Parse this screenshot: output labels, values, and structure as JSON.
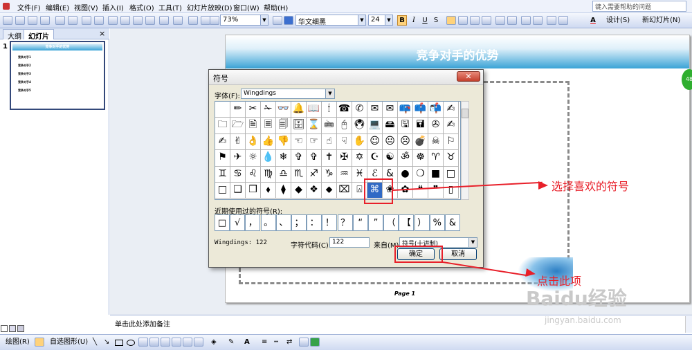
{
  "menu": {
    "items": [
      "文件(F)",
      "编辑(E)",
      "视图(V)",
      "插入(I)",
      "格式(O)",
      "工具(T)",
      "幻灯片放映(D)",
      "窗口(W)",
      "帮助(H)"
    ],
    "help_placeholder": "键入需要帮助的问题"
  },
  "toolbar": {
    "zoom": "73%",
    "font_name": "华文细黑",
    "font_size": "24",
    "bold": "B",
    "italic": "I",
    "underline": "U",
    "shadow": "S",
    "design_label": "设计(S)",
    "new_slide_label": "新幻灯片(N)"
  },
  "left_pane": {
    "tabs": [
      "大纲",
      "幻灯片"
    ],
    "slide_number": "1",
    "thumb_title": "竞争对手的优势",
    "thumb_lines": [
      "竞争对手1",
      "竞争对手2",
      "竞争对手3",
      "竞争对手4",
      "竞争对手5"
    ]
  },
  "slide": {
    "title": "竞争对手的优势",
    "page_label": "Page 1"
  },
  "notes": {
    "placeholder": "单击此处添加备注"
  },
  "drawing_toolbar": {
    "draw_label": "绘图(R)",
    "autoshapes_label": "自选图形(U)"
  },
  "dialog": {
    "title": "符号",
    "font_label": "字体(F):",
    "font_value": "Wingdings",
    "symbols": [
      "",
      "✏",
      "✂",
      "✁",
      "👓",
      "🔔",
      "📖",
      "🕯",
      "☎",
      "✆",
      "✉",
      "✉",
      "📪",
      "📫",
      "📬",
      "✍",
      "🗀",
      "🗁",
      "🗎",
      "🗏",
      "🗐",
      "🗄",
      "⌛",
      "🖮",
      "🖰",
      "🖲",
      "💻",
      "🖴",
      "🖫",
      "🖬",
      "✇",
      "✍",
      "✍",
      "✌",
      "👌",
      "👍",
      "👎",
      "☜",
      "☞",
      "☝",
      "☟",
      "✋",
      "☺",
      "😐",
      "☹",
      "💣",
      "☠",
      "⚐",
      "⚑",
      "✈",
      "☼",
      "💧",
      "❄",
      "✞",
      "✞",
      "✝",
      "✠",
      "✡",
      "☪",
      "☯",
      "ॐ",
      "☸",
      "♈",
      "♉",
      "♊",
      "♋",
      "♌",
      "♍",
      "♎",
      "♏",
      "♐",
      "♑",
      "♒",
      "♓",
      "ℰ",
      "&",
      "●",
      "❍",
      "■",
      "□",
      "□",
      "❑",
      "❒",
      "⬧",
      "⧫",
      "◆",
      "❖",
      "⬥",
      "⌧",
      "⍓",
      "⌘",
      "❀",
      "✿",
      "❝",
      "❞",
      "▯"
    ],
    "selected_symbol": "⌘",
    "recent_label": "近期使用过的符号(R):",
    "recent": [
      "□",
      "√",
      "，",
      "。",
      "、",
      "；",
      "：",
      "！",
      "？",
      "“",
      "”",
      "（",
      "【",
      "）",
      "%",
      "&"
    ],
    "char_name": "Wingdings: 122",
    "char_code_label": "字符代码(C):",
    "char_code_value": "122",
    "from_label": "来自(M):",
    "from_value": "符号(十进制)",
    "ok": "确定",
    "cancel": "取消"
  },
  "annotations": {
    "choose": "选择喜欢的符号",
    "click": "点击此项"
  },
  "watermark": {
    "brand": "Baidu经验",
    "url": "jingyan.baidu.com"
  },
  "colors": {
    "accent_red": "#e8202a",
    "selection_blue": "#316ac5"
  }
}
